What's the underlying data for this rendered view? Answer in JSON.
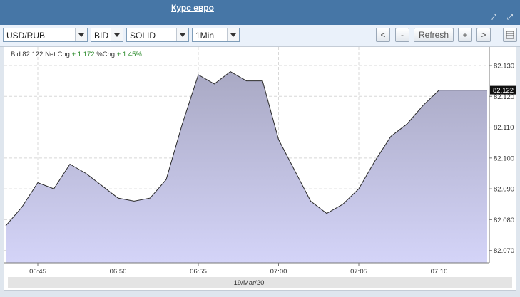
{
  "window": {
    "title": "Курс евро"
  },
  "toolbar": {
    "symbol_select": "USD/RUB",
    "price_type_select": "BID",
    "style_select": "SOLID",
    "interval_select": "1Min",
    "buttons": {
      "prev": "<",
      "zoom_out": "-",
      "refresh": "Refresh",
      "zoom_in": "+",
      "next": ">"
    }
  },
  "info": {
    "bid_label": "Bid",
    "bid_value": "82.122",
    "net_chg_label": "Net Chg",
    "net_chg_value": "+ 1.172",
    "pct_chg_label": "%Chg",
    "pct_chg_value": "+ 1.45%"
  },
  "chart_data": {
    "type": "area",
    "x": [
      "06:43",
      "06:44",
      "06:45",
      "06:46",
      "06:47",
      "06:48",
      "06:49",
      "06:50",
      "06:51",
      "06:52",
      "06:53",
      "06:54",
      "06:55",
      "06:56",
      "06:57",
      "06:58",
      "06:59",
      "07:00",
      "07:01",
      "07:02",
      "07:03",
      "07:04",
      "07:05",
      "07:06",
      "07:07",
      "07:08",
      "07:09",
      "07:10",
      "07:11",
      "07:12",
      "07:13"
    ],
    "values": [
      82.078,
      82.084,
      82.092,
      82.09,
      82.098,
      82.095,
      82.091,
      82.087,
      82.086,
      82.087,
      82.093,
      82.111,
      82.127,
      82.124,
      82.128,
      82.125,
      82.125,
      82.106,
      82.096,
      82.086,
      82.082,
      82.085,
      82.09,
      82.099,
      82.107,
      82.111,
      82.117,
      82.122,
      82.122,
      82.122,
      82.122
    ],
    "x_ticks": [
      "06:45",
      "06:50",
      "06:55",
      "07:00",
      "07:05",
      "07:10"
    ],
    "y_ticks": [
      "82.070",
      "82.080",
      "82.090",
      "82.100",
      "82.110",
      "82.120",
      "82.130"
    ],
    "ylim": [
      82.066,
      82.136
    ],
    "last_value_label": "82.122",
    "date_label": "19/Mar/20",
    "grid": true,
    "colors": {
      "fill_top": "#a9a9c4",
      "fill_bottom": "#d4d4f8",
      "line": "#2a2a2a",
      "grid": "#d8d8d8",
      "last_value_bg": "#111111",
      "positive": "#2a8a2a"
    }
  }
}
